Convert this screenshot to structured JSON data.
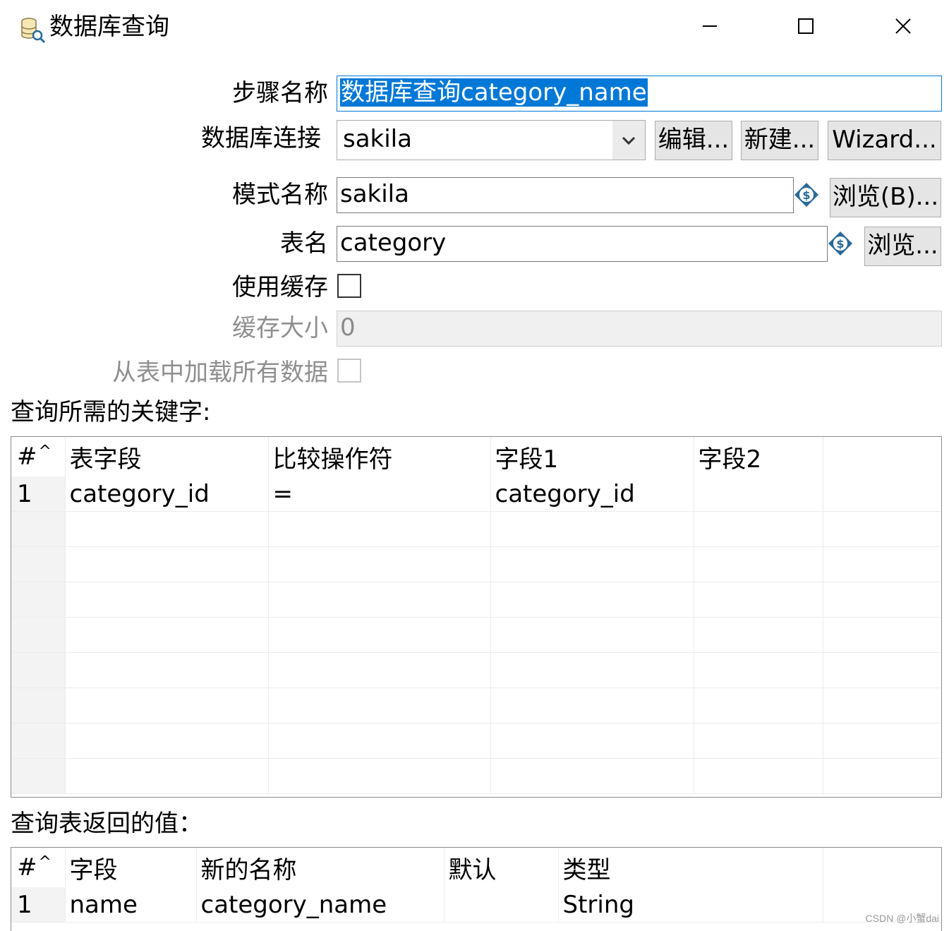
{
  "window": {
    "title": "数据库查询",
    "icon": "database-search-icon",
    "controls": [
      "minimize-icon",
      "maximize-icon",
      "close-icon"
    ]
  },
  "form": {
    "step_name": {
      "label": "步骤名称",
      "value": "数据库查询category_name"
    },
    "connection": {
      "label": "数据库连接",
      "value": "sakila",
      "edit_button": "编辑...",
      "new_button": "新建...",
      "wizard_button": "Wizard..."
    },
    "schema": {
      "label": "模式名称",
      "value": "sakila",
      "browse_button": "浏览(B)..."
    },
    "table": {
      "label": "表名",
      "value": "category",
      "browse_button": "浏览..."
    },
    "use_cache": {
      "label": "使用缓存",
      "checked": false
    },
    "cache_size": {
      "label": "缓存大小",
      "value": "0"
    },
    "load_all": {
      "label": "从表中加载所有数据",
      "checked": false
    }
  },
  "keys_section": {
    "title": "查询所需的关键字:",
    "columns": [
      "#",
      "表字段",
      "比较操作符",
      "字段1",
      "字段2"
    ],
    "rows": [
      [
        "1",
        "category_id",
        "=",
        "category_id",
        ""
      ]
    ]
  },
  "returns_section": {
    "title": "查询表返回的值：",
    "columns": [
      "#",
      "字段",
      "新的名称",
      "默认",
      "类型"
    ],
    "rows": [
      [
        "1",
        "name",
        "category_name",
        "",
        "String"
      ]
    ]
  },
  "watermark": "CSDN @小蟹dai",
  "colors": {
    "selection": "#0078d7",
    "button_bg": "#e5e5e5",
    "disabled_text": "#8f8f8f",
    "variable_icon": "#2a6a98"
  }
}
